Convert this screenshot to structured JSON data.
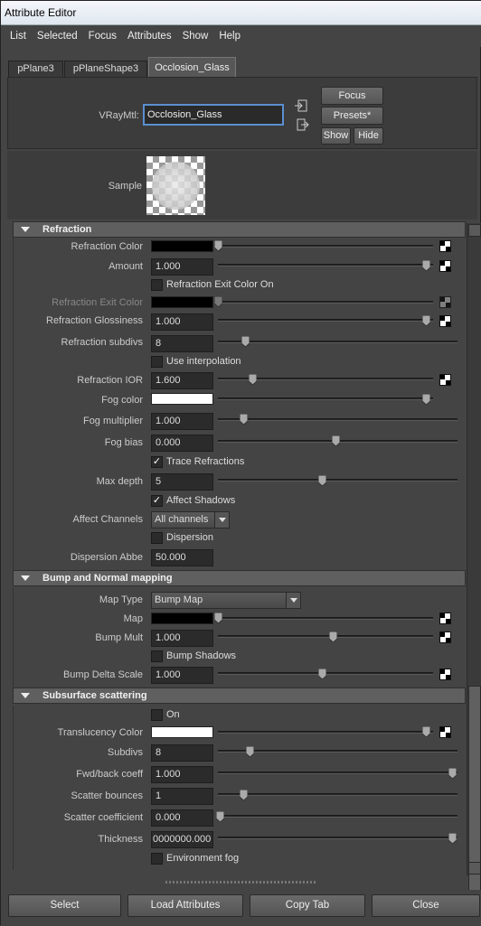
{
  "window": {
    "title": "Attribute Editor"
  },
  "menu": [
    "List",
    "Selected",
    "Focus",
    "Attributes",
    "Show",
    "Help"
  ],
  "tabs": [
    "pPlane3",
    "pPlaneShape3",
    "Occlosion_Glass"
  ],
  "header": {
    "type_label": "VRayMtl:",
    "name_value": "Occlosion_Glass",
    "focus": "Focus",
    "presets": "Presets*",
    "show": "Show",
    "hide": "Hide"
  },
  "sample": {
    "label": "Sample"
  },
  "refraction": {
    "title": "Refraction",
    "refraction_color": "Refraction Color",
    "amount": "Amount",
    "amount_value": "1.000",
    "exit_color_on": "Refraction Exit Color On",
    "exit_color": "Refraction Exit Color",
    "glossiness": "Refraction Glossiness",
    "glossiness_value": "1.000",
    "subdivs": "Refraction subdivs",
    "subdivs_value": "8",
    "use_interp": "Use interpolation",
    "ior": "Refraction IOR",
    "ior_value": "1.600",
    "fog_color": "Fog color",
    "fog_mult": "Fog multiplier",
    "fog_mult_value": "1.000",
    "fog_bias": "Fog bias",
    "fog_bias_value": "0.000",
    "trace": "Trace Refractions",
    "max_depth": "Max depth",
    "max_depth_value": "5",
    "affect_shadows": "Affect Shadows",
    "affect_channels": "Affect Channels",
    "affect_channels_value": "All channels",
    "dispersion": "Dispersion",
    "dispersion_abbe": "Dispersion Abbe",
    "dispersion_abbe_value": "50.000"
  },
  "bump": {
    "title": "Bump and Normal mapping",
    "map_type": "Map Type",
    "map_type_value": "Bump Map",
    "map": "Map",
    "bump_mult": "Bump Mult",
    "bump_mult_value": "1.000",
    "bump_shadows": "Bump Shadows",
    "delta_scale": "Bump Delta Scale",
    "delta_scale_value": "1.000"
  },
  "sss": {
    "title": "Subsurface scattering",
    "on": "On",
    "trans_color": "Translucency Color",
    "subdivs": "Subdivs",
    "subdivs_value": "8",
    "fwd_back": "Fwd/back coeff",
    "fwd_back_value": "1.000",
    "scatter_bounces": "Scatter bounces",
    "scatter_bounces_value": "1",
    "scatter_coeff": "Scatter coefficient",
    "scatter_coeff_value": "0.000",
    "thickness": "Thickness",
    "thickness_value": "0000000.000",
    "env_fog": "Environment fog"
  },
  "footer": {
    "select": "Select",
    "load": "Load Attributes",
    "copy": "Copy Tab",
    "close": "Close"
  },
  "colors": {
    "black": "#000000",
    "white": "#ffffff",
    "panel": "#444444",
    "accent": "#5a8fd0"
  }
}
